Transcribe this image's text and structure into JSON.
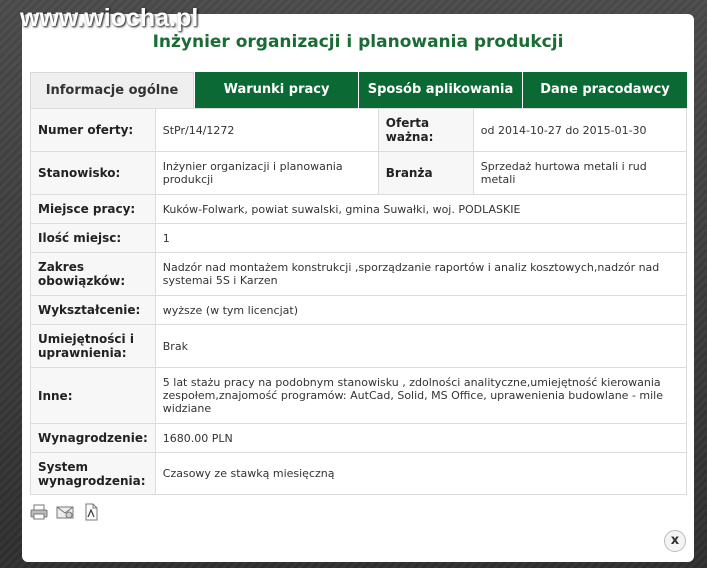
{
  "watermark": "www.wiocha.pl",
  "title": "Inżynier organizacji i planowania produkcji",
  "tabs": [
    {
      "label": "Informacje ogólne"
    },
    {
      "label": "Warunki pracy"
    },
    {
      "label": "Sposób aplikowania"
    },
    {
      "label": "Dane pracodawcy"
    }
  ],
  "offer": {
    "numer_label": "Numer oferty:",
    "numer": "StPr/14/1272",
    "waznosc_label": "Oferta ważna:",
    "waznosc": "od 2014-10-27 do 2015-01-30",
    "stanowisko_label": "Stanowisko:",
    "stanowisko": "Inżynier organizacji i planowania produkcji",
    "branza_label": "Branża",
    "branza": "Sprzedaż hurtowa metali i rud metali",
    "miejsce_label": "Miejsce pracy:",
    "miejsce": "Kuków-Folwark, powiat suwalski, gmina Suwałki, woj. PODLASKIE",
    "ilosc_label": "Ilość miejsc:",
    "ilosc": "1",
    "zakres_label": "Zakres obowiązków:",
    "zakres": "Nadzór nad montażem konstrukcji ,sporządzanie raportów i analiz kosztowych,nadzór nad systemai 5S i Karzen",
    "wyksztalcenie_label": "Wykształcenie:",
    "wyksztalcenie": "wyższe (w tym licencjat)",
    "umiejetnosci_label": "Umiejętności i uprawnienia:",
    "umiejetnosci": "Brak",
    "inne_label": "Inne:",
    "inne": "5 lat stażu pracy na podobnym stanowisku , zdolności analityczne,umiejętność kierowania zespołem,znajomość programów: AutCad, Solid, MS Office, uprawenienia budowlane - mile widziane",
    "wynagrodzenie_label": "Wynagrodzenie:",
    "wynagrodzenie": "1680.00 PLN",
    "system_label": "System wynagrodzenia:",
    "system": "Czasowy ze stawką miesięczną"
  },
  "icons": [
    "printer-icon",
    "email-icon",
    "pdf-icon"
  ],
  "close_label": "x"
}
